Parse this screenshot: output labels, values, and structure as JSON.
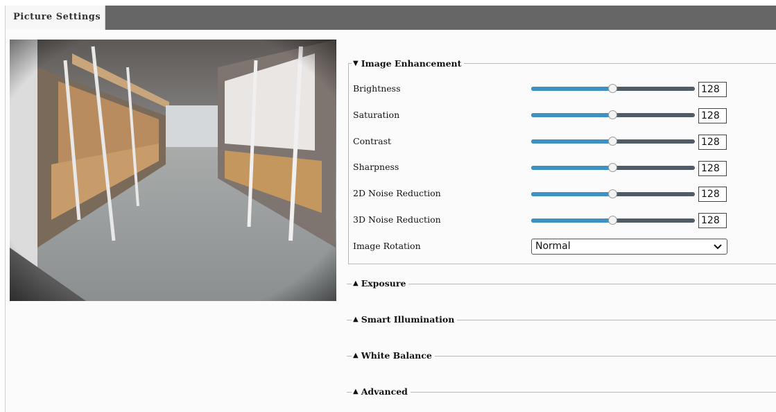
{
  "tab": {
    "label": "Picture Settings"
  },
  "preview": {
    "alt": "camera-preview"
  },
  "image_enhancement": {
    "title": "Image Enhancement",
    "sliders": [
      {
        "label": "Brightness",
        "value": "128",
        "fraction": 0.5
      },
      {
        "label": "Saturation",
        "value": "128",
        "fraction": 0.5
      },
      {
        "label": "Contrast",
        "value": "128",
        "fraction": 0.5
      },
      {
        "label": "Sharpness",
        "value": "128",
        "fraction": 0.5
      },
      {
        "label": "2D Noise Reduction",
        "value": "128",
        "fraction": 0.5
      },
      {
        "label": "3D Noise Reduction",
        "value": "128",
        "fraction": 0.5
      }
    ],
    "rotation": {
      "label": "Image Rotation",
      "selected": "Normal"
    }
  },
  "sections": {
    "exposure": "Exposure",
    "smart_illumination": "Smart Illumination",
    "white_balance": "White Balance",
    "advanced": "Advanced"
  },
  "colors": {
    "topbar": "#666666",
    "slider_fill": "#3d92c1",
    "slider_track": "#505b67"
  }
}
